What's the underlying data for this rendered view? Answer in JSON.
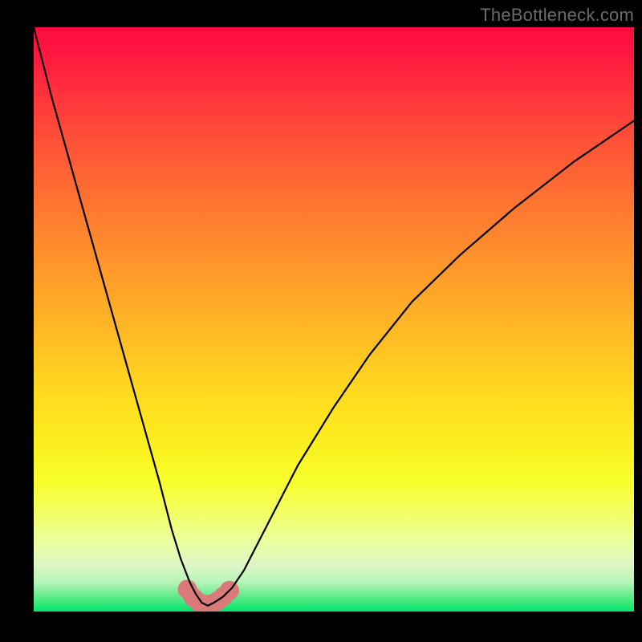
{
  "watermark": "TheBottleneck.com",
  "chart_data": {
    "type": "line",
    "title": "",
    "xlabel": "",
    "ylabel": "",
    "xlim": [
      0,
      100
    ],
    "ylim": [
      0,
      100
    ],
    "legend": false,
    "grid": false,
    "background_gradient": {
      "orientation": "top-to-bottom",
      "stops": [
        {
          "pos": 0.0,
          "color": "#ff0b3e"
        },
        {
          "pos": 0.33,
          "color": "#ff7e2f"
        },
        {
          "pos": 0.62,
          "color": "#ffd81f"
        },
        {
          "pos": 0.78,
          "color": "#f7ff2e"
        },
        {
          "pos": 0.92,
          "color": "#def6c6"
        },
        {
          "pos": 1.0,
          "color": "#00e770"
        }
      ]
    },
    "series": [
      {
        "name": "bottleneck-curve",
        "color": "#000000",
        "x": [
          0,
          3,
          6,
          9,
          12,
          15,
          18,
          21,
          23,
          24.5,
          26,
          27,
          28,
          29,
          30,
          31.5,
          33,
          35,
          37,
          40,
          44,
          50,
          56,
          63,
          71,
          80,
          90,
          100
        ],
        "y": [
          100,
          88,
          77,
          66,
          55,
          44,
          33,
          22,
          14,
          9,
          5,
          3,
          1.5,
          1,
          1.5,
          2.5,
          4,
          7,
          11,
          17,
          25,
          35,
          44,
          53,
          61,
          69,
          77,
          84
        ]
      }
    ],
    "highlight": {
      "name": "min-region",
      "color": "#da7a7a",
      "stroke_width": 10,
      "x": [
        25.6,
        26.6,
        27.6,
        28.6,
        29.6,
        30.6,
        31.6,
        32.6
      ],
      "y": [
        3.8,
        2.4,
        1.5,
        1.2,
        1.3,
        1.8,
        2.6,
        3.6
      ]
    }
  }
}
